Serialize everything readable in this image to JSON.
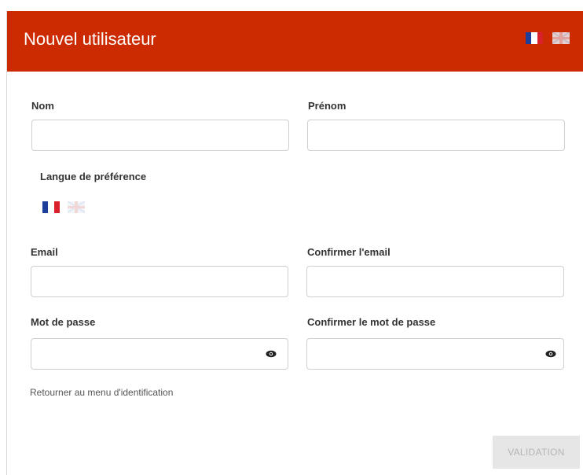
{
  "header": {
    "title": "Nouvel utilisateur",
    "flags": [
      {
        "icon": "flag-france-icon"
      },
      {
        "icon": "flag-uk-icon"
      }
    ]
  },
  "form": {
    "nom_label": "Nom",
    "nom_value": "",
    "prenom_label": "Prénom",
    "prenom_value": "",
    "langue_label": "Langue de préférence",
    "langue_flags": [
      {
        "icon": "flag-france-icon"
      },
      {
        "icon": "flag-uk-icon"
      }
    ],
    "email_label": "Email",
    "email_value": "",
    "confirm_email_label": "Confirmer l'email",
    "confirm_email_value": "",
    "password_label": "Mot de passe",
    "password_value": "",
    "confirm_password_label": "Confirmer le mot de passe",
    "confirm_password_value": "",
    "toggle_icon": "eye-icon"
  },
  "links": {
    "back_to_login": "Retourner au menu d'identification"
  },
  "actions": {
    "validate_label": "VALIDATION"
  },
  "colors": {
    "header_bg": "#cc2a00",
    "header_text": "#ffffff",
    "button_disabled_bg": "#e6e6e6",
    "button_disabled_text": "#b5b5b5",
    "france_blue": "#1d3f9a",
    "france_white": "#ffffff",
    "france_red": "#d8212a"
  }
}
